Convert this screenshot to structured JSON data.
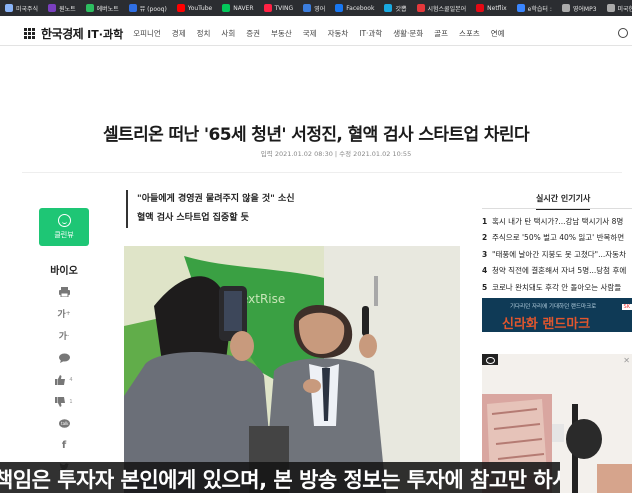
{
  "bookmarks": [
    {
      "label": "미국주식",
      "icon": "globe-icon",
      "color": "#8ab4f8"
    },
    {
      "label": "원노트",
      "icon": "onenote-icon",
      "color": "#7a3fbf"
    },
    {
      "label": "에버노트",
      "icon": "evernote-icon",
      "color": "#2dbe60"
    },
    {
      "label": "뮤 (pooq)",
      "icon": "pooq-icon",
      "color": "#2f6fe4"
    },
    {
      "label": "YouTube",
      "icon": "youtube-icon",
      "color": "#ff0000"
    },
    {
      "label": "NAVER",
      "icon": "naver-icon",
      "color": "#03c75a"
    },
    {
      "label": "TVING",
      "icon": "tving-icon",
      "color": "#ff2244"
    },
    {
      "label": "영어",
      "icon": "s-icon",
      "color": "#3b7ddd"
    },
    {
      "label": "Facebook",
      "icon": "facebook-icon",
      "color": "#1877f2"
    },
    {
      "label": "갓뽑",
      "icon": "link-icon",
      "color": "#19a9e1"
    },
    {
      "label": "시험스쿨일본어",
      "icon": "s-icon",
      "color": "#e5383b"
    },
    {
      "label": "Netflix",
      "icon": "netflix-icon",
      "color": "#e50914"
    },
    {
      "label": "e학습터 :",
      "icon": "e-icon",
      "color": "#3a86ff"
    },
    {
      "label": "영어MP3",
      "icon": "globe-icon",
      "color": "#aaaaaa"
    },
    {
      "label": "미국현재",
      "icon": "globe-icon",
      "color": "#aaaaaa"
    }
  ],
  "nav": {
    "logo": "한국경제",
    "section": "IT·과학",
    "menu": [
      "오피니언",
      "경제",
      "정치",
      "사회",
      "증권",
      "부동산",
      "국제",
      "자동차",
      "IT·과학",
      "생활·문화",
      "골프",
      "스포츠",
      "연예"
    ]
  },
  "article": {
    "headline": "셀트리온 떠난 '65세 청년' 서정진, 혈액 검사 스타트업 차린다",
    "dates": "입력 2021.01.02 08:30 | 수정 2021.01.02 10:55",
    "summary_line1": "\"아들에게 경영권 물려주지 않을 것\" 소신",
    "summary_line2": "혈액 검사 스타트업 집중할 듯",
    "photo_sign": "NextRise"
  },
  "sidebar": {
    "clean_label": "클린뷰",
    "tag": "바이오",
    "like_count": "4",
    "dislike_count": "1"
  },
  "popular": {
    "title": "실시간 인기기사",
    "items": [
      {
        "num": "1",
        "text": "혹시 내가 탄 택시가?...강남 택시기사 8명"
      },
      {
        "num": "2",
        "text": "주식으로 '50% 벌고 40% 잃고' 반복하면"
      },
      {
        "num": "3",
        "text": "\"태풍에 날아간 지붕도 못 고쳤다\"...자동차"
      },
      {
        "num": "4",
        "text": "청약 직전에 결혼해서 자녀 5명...당첨 후에"
      },
      {
        "num": "5",
        "text": "코로나 완치돼도 후각 안 돌아오는 사람들"
      }
    ]
  },
  "ad1": {
    "small": "기다리던 자리에 기대하던 랜드마크로",
    "big": "신라화 랜드마크",
    "tag": "SK"
  },
  "ticker": {
    "text": "책임은 투자자 본인에게 있으며, 본 방송 정보는 투자에 참고만 하시기 바랍니다"
  }
}
